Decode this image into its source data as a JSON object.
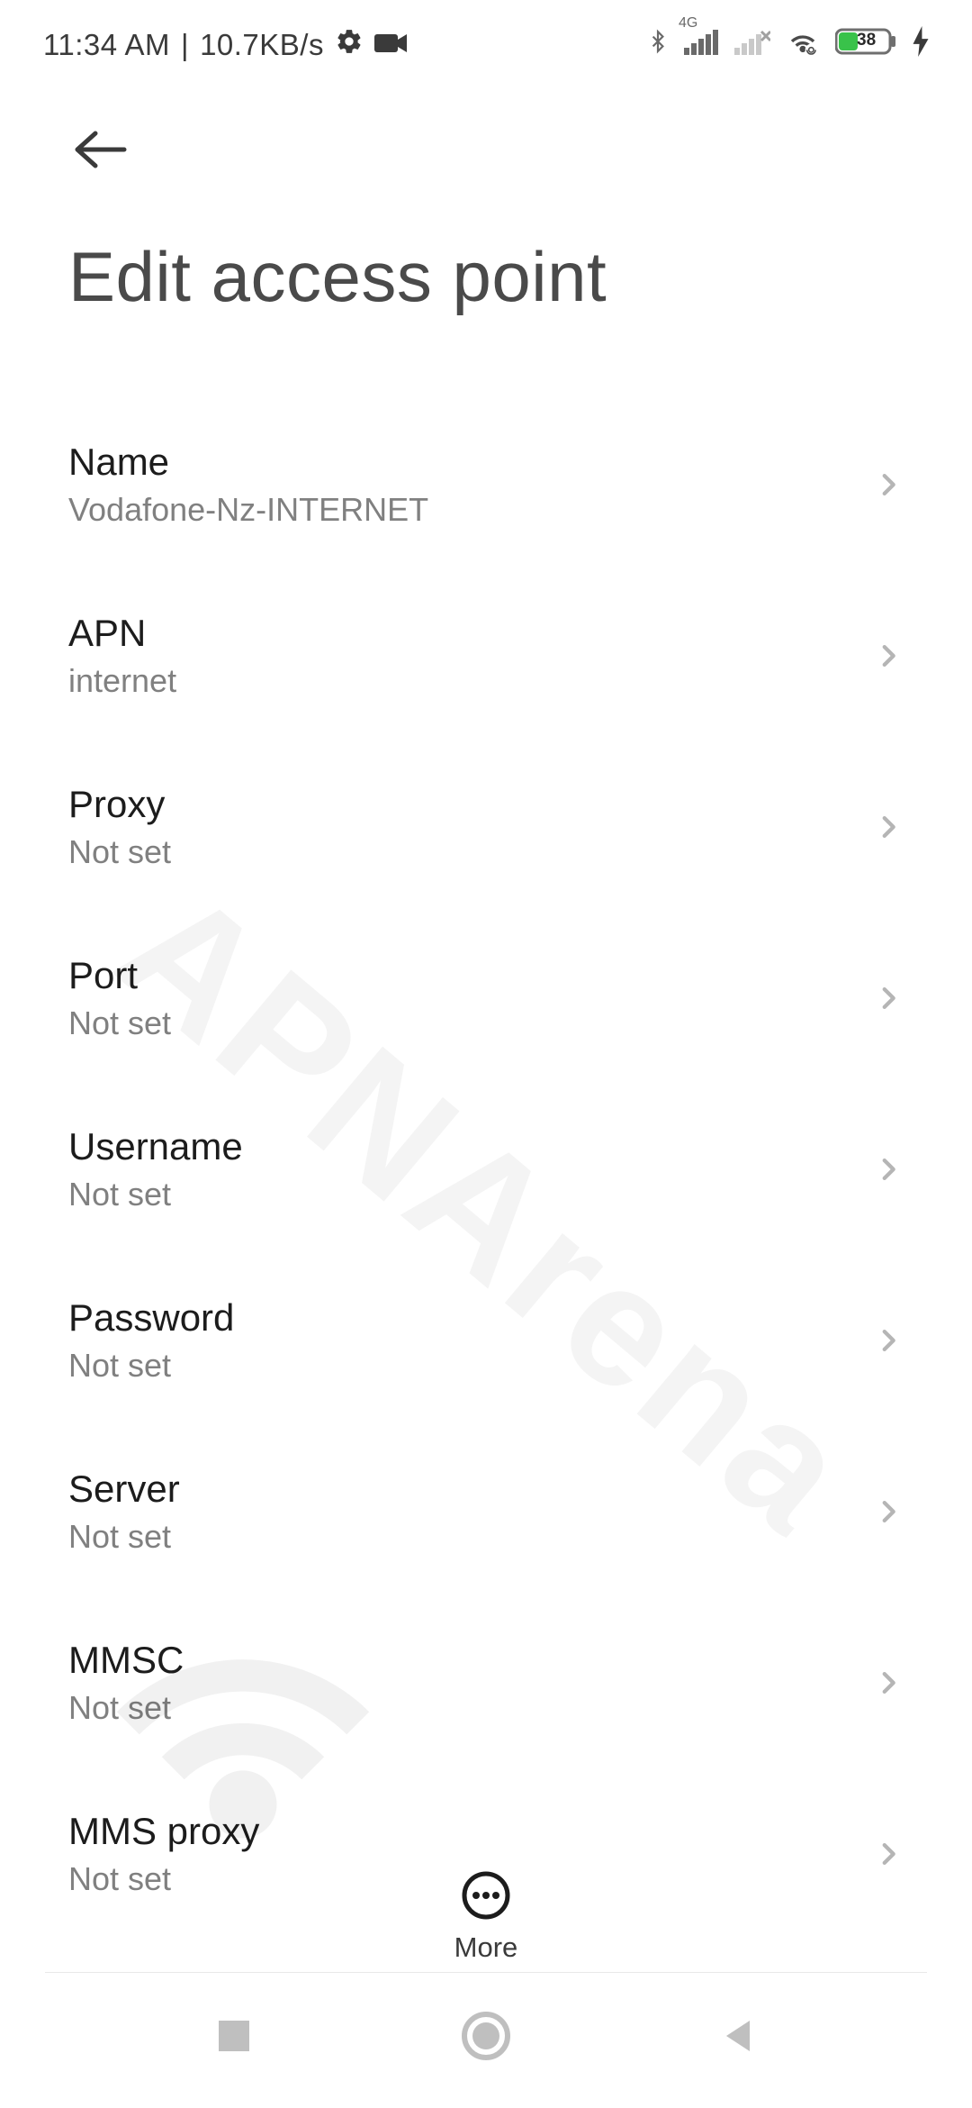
{
  "statusbar": {
    "time": "11:34 AM",
    "separator": "|",
    "speed": "10.7KB/s",
    "network_label": "4G",
    "battery_pct": "38"
  },
  "header": {
    "title": "Edit access point"
  },
  "watermark": "APNArena",
  "items": [
    {
      "label": "Name",
      "value": "Vodafone-Nz-INTERNET"
    },
    {
      "label": "APN",
      "value": "internet"
    },
    {
      "label": "Proxy",
      "value": "Not set"
    },
    {
      "label": "Port",
      "value": "Not set"
    },
    {
      "label": "Username",
      "value": "Not set"
    },
    {
      "label": "Password",
      "value": "Not set"
    },
    {
      "label": "Server",
      "value": "Not set"
    },
    {
      "label": "MMSC",
      "value": "Not set"
    },
    {
      "label": "MMS proxy",
      "value": "Not set"
    }
  ],
  "toolbar": {
    "more_label": "More"
  }
}
